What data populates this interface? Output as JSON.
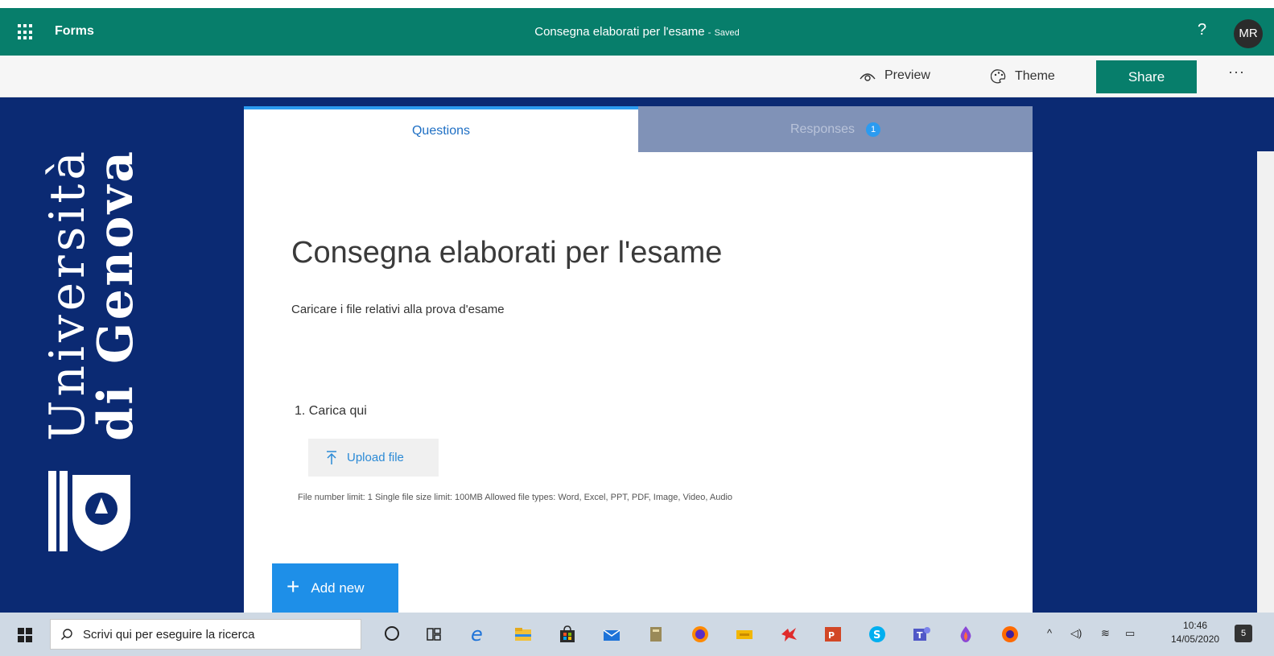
{
  "app": {
    "name": "Forms",
    "doc_title": "Consegna elaborati per l'esame",
    "separator": "-",
    "save_status": "Saved",
    "help": "?",
    "avatar_initials": "MR",
    "brand_color": "#077e6b"
  },
  "command_bar": {
    "preview_label": "Preview",
    "theme_label": "Theme",
    "share_label": "Share",
    "more_label": "···"
  },
  "brand": {
    "line1": "Università",
    "line2": "di Genova",
    "background": "#0b2a73"
  },
  "tabs": {
    "questions_label": "Questions",
    "responses_label": "Responses",
    "responses_count": "1"
  },
  "form": {
    "title": "Consegna elaborati per l'esame",
    "description": "Caricare i file relativi alla prova d'esame",
    "question_label": "1. Carica qui",
    "upload_label": "Upload file",
    "limits_text": "File number limit: 1   Single file size limit: 100MB   Allowed file types: Word, Excel, PPT, PDF, Image, Video, Audio",
    "add_new_label": "Add new"
  },
  "taskbar": {
    "search_placeholder": "Scrivi qui per eseguire la ricerca",
    "time": "10:46",
    "date": "14/05/2020",
    "notifications_count": "5",
    "icons": [
      "cortana-icon",
      "task-view-icon",
      "edge-icon",
      "file-explorer-icon",
      "store-icon",
      "mail-icon",
      "archive-icon",
      "firefox-icon",
      "ticket-icon",
      "lizard-icon",
      "powerpoint-icon",
      "skype-icon",
      "teams-icon",
      "paint-drop-icon",
      "firefox-alt-icon"
    ]
  }
}
